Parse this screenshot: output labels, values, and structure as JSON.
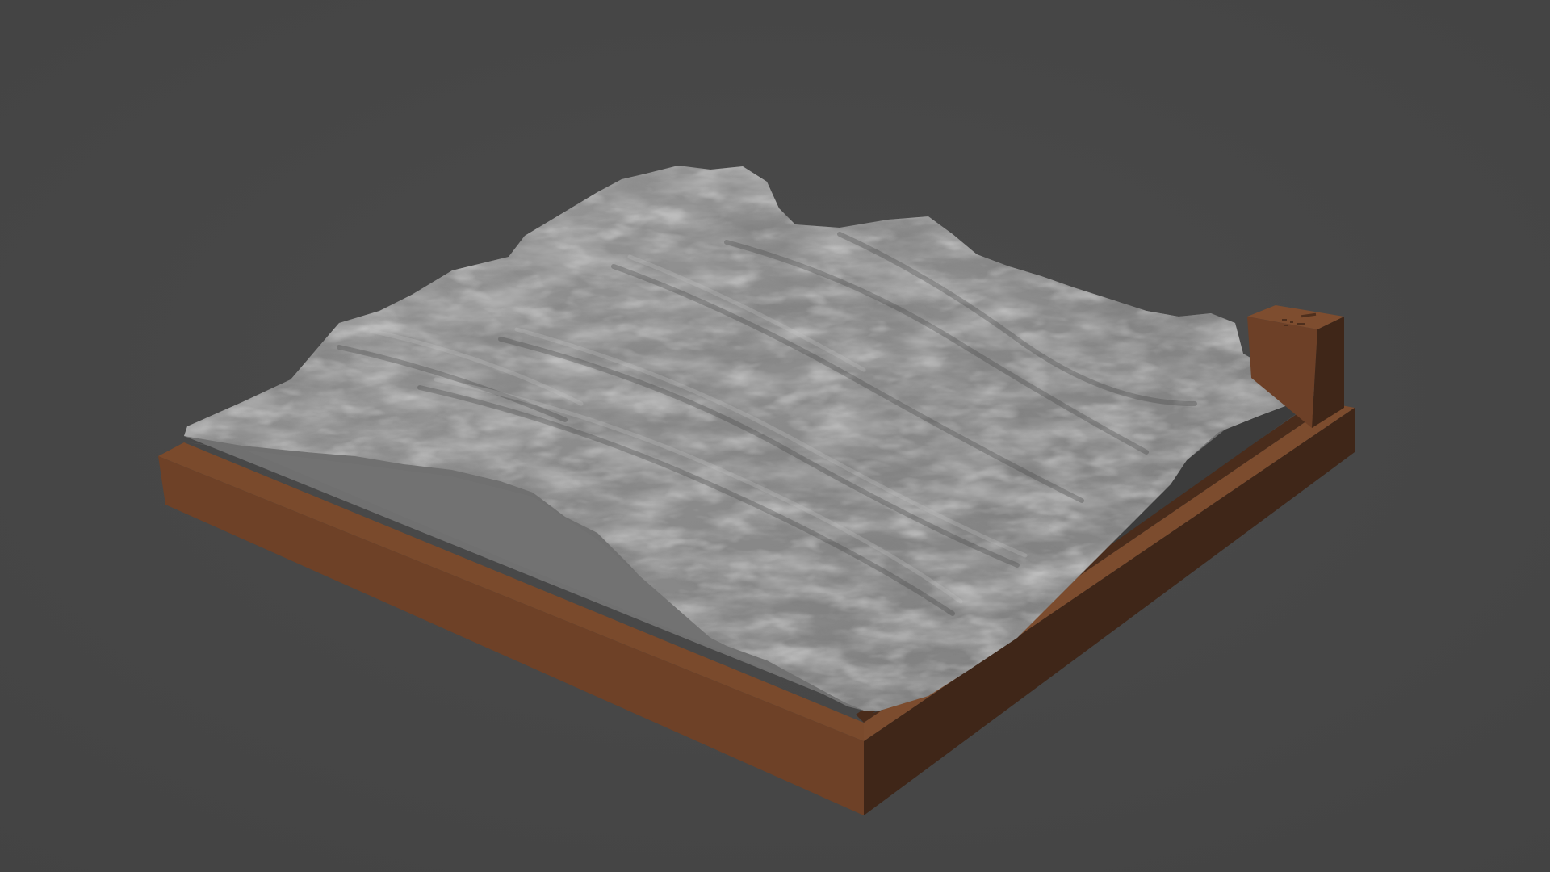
{
  "scene": {
    "background_color": "#474747",
    "terrain_color": "#8e8e8e",
    "terrain_highlight": "#b4b4b4",
    "terrain_shadow": "#5a5a5a",
    "base_plate_color": "#6f6f6f",
    "frame_color": "#74462a",
    "frame_dark_color": "#3e2518",
    "frame_mid_color": "#5a3520"
  }
}
